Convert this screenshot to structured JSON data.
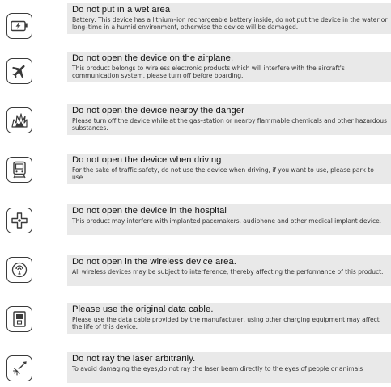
{
  "items": [
    {
      "icon": "battery-charging-icon",
      "title": "Do not put in a wet area",
      "desc": "Battery: This device has a lithium–ion rechargeable battery inside, do not put the device in the water or long–time in a humid environment, otherwise the device will be damaged."
    },
    {
      "icon": "airplane-icon",
      "title": "Do not open the device on the airplane.",
      "desc": "This product belongs to wireless electronic products which will interfere with the aircraft's communication system, please turn off before boarding."
    },
    {
      "icon": "explosion-icon",
      "title": "Do not open the device nearby the danger",
      "desc": "Please turn off the device while at the gas–station or nearby flammable chemicals and other hazardous substances."
    },
    {
      "icon": "train-icon",
      "title": "Do not open the device when driving",
      "desc": "For the sake of traffic safety, do not use the device when driving, if you want to use, please park to use."
    },
    {
      "icon": "hospital-cross-icon",
      "title": "Do not open the device in the hospital",
      "desc": "This product may interfere with implanted pacemakers, audiphone and other medical implant device."
    },
    {
      "icon": "wireless-signal-icon",
      "title": "Do not open in the wireless device area.",
      "desc": "All wireless devices may be subject to interference, thereby affecting the performance of this product."
    },
    {
      "icon": "usb-connector-icon",
      "title": "Please use the original data cable.",
      "desc": "Please use the data cable provided by the manufacturer, using other charging equipment may affect the life of this device."
    },
    {
      "icon": "laser-icon",
      "title": "Do not ray the laser arbitrarily.",
      "desc": "To avoid damaging the eyes,do not ray the laser beam directly to the eyes of people or animals"
    }
  ]
}
